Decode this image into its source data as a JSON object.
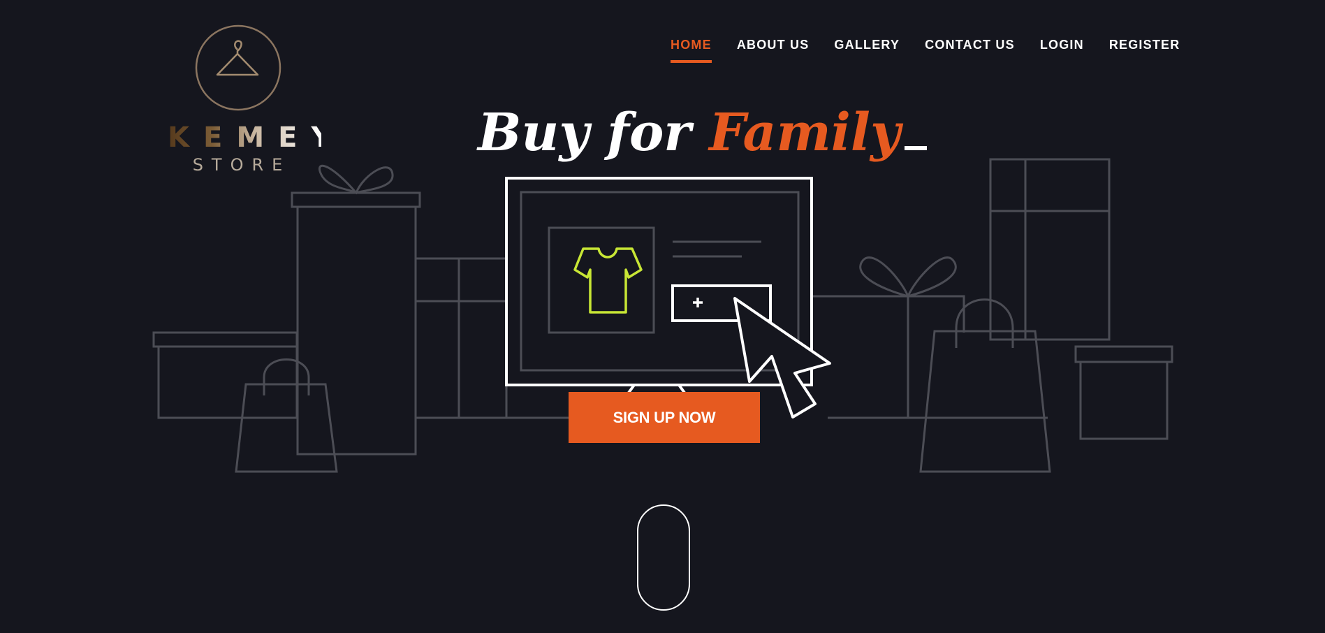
{
  "brand": {
    "name": "KEMEY",
    "subtitle": "STORE",
    "logo_icon": "hanger-icon"
  },
  "nav": {
    "items": [
      {
        "label": "HOME",
        "active": true
      },
      {
        "label": "ABOUT US",
        "active": false
      },
      {
        "label": "GALLERY",
        "active": false
      },
      {
        "label": "CONTACT US",
        "active": false
      },
      {
        "label": "LOGIN",
        "active": false
      },
      {
        "label": "REGISTER",
        "active": false
      }
    ]
  },
  "hero": {
    "headline_prefix": "Buy for",
    "headline_accent": "Family",
    "cta_label": "SIGN UP NOW"
  },
  "icons": {
    "illustration": "shopping-illustration",
    "tshirt": "tshirt-icon",
    "plus": "plus-icon",
    "cursor": "mouse-cursor-icon",
    "scroll": "scroll-mouse-icon"
  },
  "colors": {
    "background": "#15161e",
    "accent": "#e65a20",
    "tshirt": "#c8e635",
    "line_art": "#4c4d55"
  }
}
